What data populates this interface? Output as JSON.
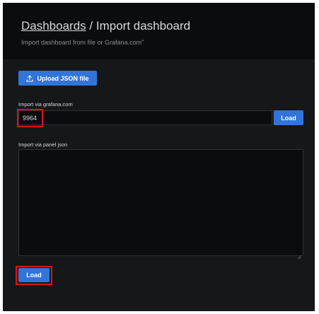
{
  "header": {
    "breadcrumb_link": "Dashboards",
    "separator": "/",
    "title": "Import dashboard",
    "subtitle": "Import dashboard from file or Grafana.com\""
  },
  "upload": {
    "label": "Upload JSON file",
    "icon": "upload-icon"
  },
  "grafana_com": {
    "label": "Import via grafana.com",
    "value": "9964",
    "load_label": "Load"
  },
  "panel_json": {
    "label": "Import via panel json",
    "value": "",
    "load_label": "Load"
  },
  "colors": {
    "accent": "#3274d9",
    "highlight": "#e0121a",
    "background": "#161719",
    "header_background": "#0b0c0e"
  }
}
